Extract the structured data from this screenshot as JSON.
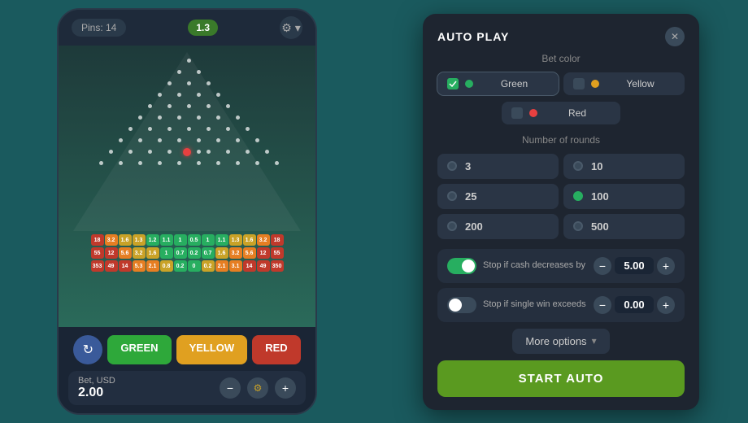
{
  "left": {
    "header": {
      "pins_label": "Pins: 14",
      "multiplier": "1.3",
      "settings": "⚙"
    },
    "controls": {
      "refresh_icon": "↻",
      "green_btn": "GREEN",
      "yellow_btn": "YELLOW",
      "red_btn": "RED",
      "bet_label": "Bet, USD",
      "bet_value": "2.00",
      "minus": "−",
      "plus": "+"
    }
  },
  "right": {
    "title": "AUTO PLAY",
    "close": "✕",
    "bet_color_section": "Bet color",
    "colors": [
      {
        "label": "Green",
        "color": "#27ae60",
        "active": true
      },
      {
        "label": "Yellow",
        "color": "#e0a020",
        "active": false
      },
      {
        "label": "Red",
        "color": "#e84040",
        "active": false
      }
    ],
    "rounds_section": "Number of rounds",
    "rounds": [
      {
        "label": "3",
        "active": false
      },
      {
        "label": "10",
        "active": false
      },
      {
        "label": "25",
        "active": false
      },
      {
        "label": "100",
        "active": true
      },
      {
        "label": "200",
        "active": false
      },
      {
        "label": "500",
        "active": false
      }
    ],
    "stop1": {
      "label": "Stop if cash decreases by",
      "value": "5.00",
      "enabled": true
    },
    "stop2": {
      "label": "Stop if single win exceeds",
      "value": "0.00",
      "enabled": false
    },
    "more_options": "More options",
    "chevron": "▾",
    "start_btn": "START AUTO"
  }
}
